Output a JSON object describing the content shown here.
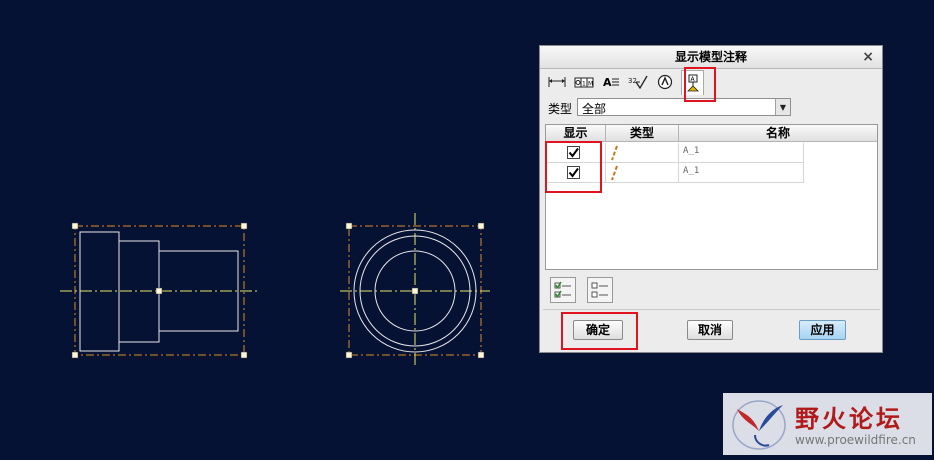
{
  "dialog": {
    "title": "显示模型注释",
    "close_glyph": "×",
    "tabs": [
      {
        "icon": "dimension-icon"
      },
      {
        "icon": "geometric-tolerance-icon"
      },
      {
        "icon": "note-icon"
      },
      {
        "icon": "surface-finish-icon"
      },
      {
        "icon": "symbol-icon"
      },
      {
        "icon": "datum-icon",
        "active": true
      }
    ],
    "type_label": "类型",
    "type_value": "全部",
    "dropdown_glyph": "▼",
    "table": {
      "headers": [
        "显示",
        "类型",
        "名称"
      ],
      "rows": [
        {
          "checked": true,
          "name": "A_1"
        },
        {
          "checked": true,
          "name": "A_1"
        }
      ]
    },
    "buttons": {
      "confirm": "确定",
      "cancel": "取消",
      "apply": "应用"
    }
  },
  "watermark": {
    "title": "野火论坛",
    "url": "www.proewildfire.cn"
  },
  "colors": {
    "background": "#061233",
    "highlight": "#e0141e",
    "centerline": "#e7e76a",
    "boundary": "#e08a25"
  }
}
